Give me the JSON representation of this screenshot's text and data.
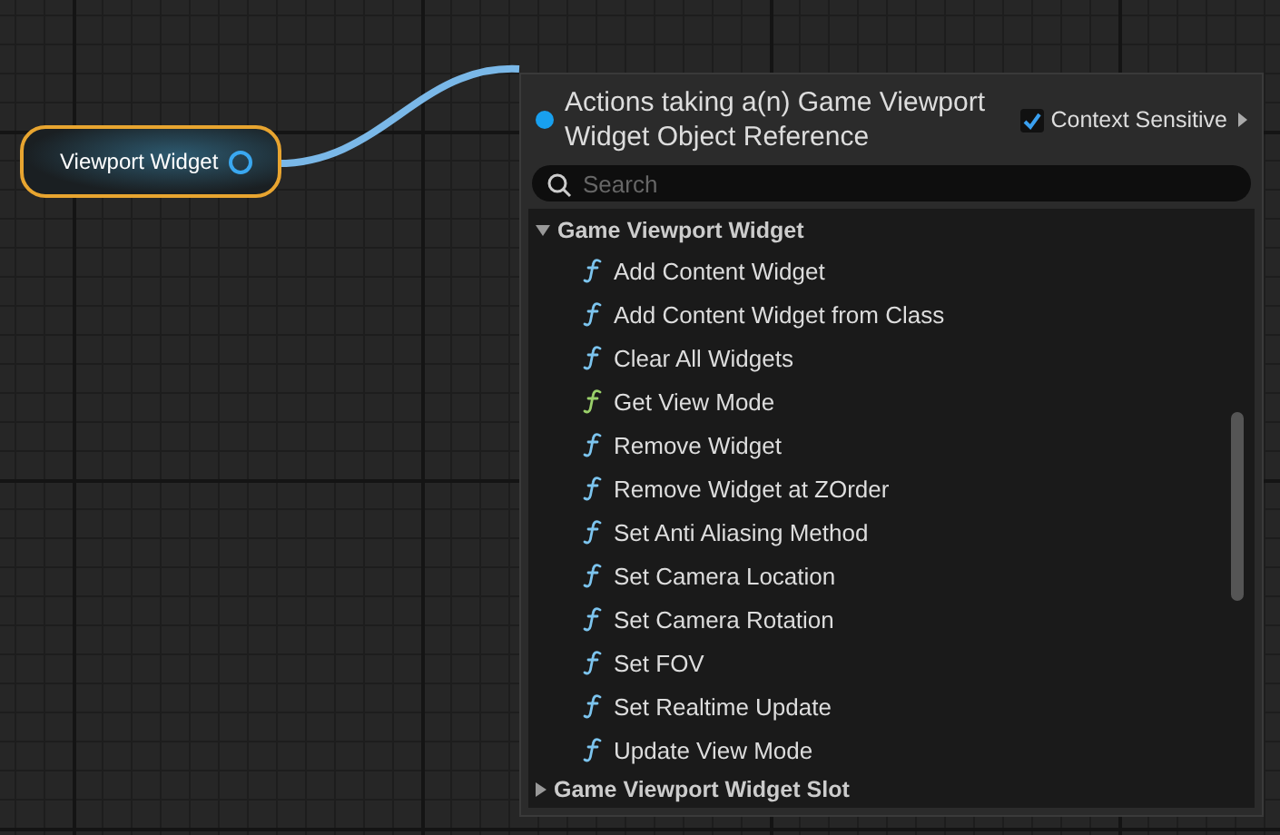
{
  "graph_node": {
    "label": "Viewport Widget"
  },
  "action_menu": {
    "title": "Actions taking a(n) Game Viewport Widget Object Reference",
    "context_sensitive": {
      "label": "Context Sensitive",
      "checked": true
    },
    "search": {
      "placeholder": "Search"
    },
    "categories": [
      {
        "label": "Game Viewport Widget",
        "expanded": true,
        "children": [
          {
            "label": "Add Content Widget",
            "kind": "impure"
          },
          {
            "label": "Add Content Widget from Class",
            "kind": "impure"
          },
          {
            "label": "Clear All Widgets",
            "kind": "impure"
          },
          {
            "label": "Get View Mode",
            "kind": "pure"
          },
          {
            "label": "Remove Widget",
            "kind": "impure"
          },
          {
            "label": "Remove Widget at ZOrder",
            "kind": "impure"
          },
          {
            "label": "Set Anti Aliasing Method",
            "kind": "impure"
          },
          {
            "label": "Set Camera Location",
            "kind": "impure"
          },
          {
            "label": "Set Camera Rotation",
            "kind": "impure"
          },
          {
            "label": "Set FOV",
            "kind": "impure"
          },
          {
            "label": "Set Realtime Update",
            "kind": "impure"
          },
          {
            "label": "Update View Mode",
            "kind": "impure"
          }
        ]
      },
      {
        "label": "Game Viewport Widget Slot",
        "expanded": false
      }
    ]
  }
}
